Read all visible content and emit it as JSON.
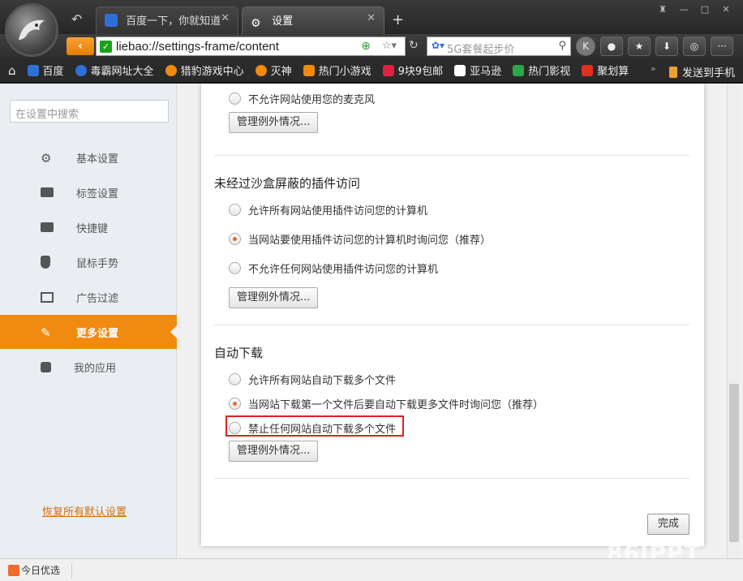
{
  "tabs": [
    {
      "label": "百度一下，你就知道",
      "icon": "baidu-paw-icon"
    },
    {
      "label": "设置",
      "icon": "gear-icon"
    }
  ],
  "window_controls": [
    "shirt-icon",
    "minimize-icon",
    "maximize-icon",
    "close-icon"
  ],
  "address_bar": {
    "url": "liebao://settings-frame/content"
  },
  "search_box": {
    "placeholder": "5G套餐起步价"
  },
  "toolbar_icons": [
    "account-icon",
    "lock-icon",
    "star-icon",
    "download-icon",
    "gamepad-icon",
    "more-icon"
  ],
  "bookmarks": [
    {
      "label": "百度",
      "color": "#2f6fd8"
    },
    {
      "label": "毒霸网址大全",
      "color": "#2f6fd8"
    },
    {
      "label": "猎豹游戏中心",
      "color": "#f08a10"
    },
    {
      "label": "灭神",
      "color": "#f08a10"
    },
    {
      "label": "热门小游戏",
      "color": "#f08a10"
    },
    {
      "label": "9块9包邮",
      "color": "#e02040"
    },
    {
      "label": "亚马逊",
      "color": "#222222"
    },
    {
      "label": "热门影视",
      "color": "#2aa84a"
    },
    {
      "label": "聚划算",
      "color": "#e03020"
    }
  ],
  "send_to_phone": "发送到手机",
  "sidebar": {
    "search_placeholder": "在设置中搜索",
    "items": [
      {
        "label": "基本设置",
        "icon": "gear-icon"
      },
      {
        "label": "标签设置",
        "icon": "tab-icon"
      },
      {
        "label": "快捷键",
        "icon": "keyboard-icon"
      },
      {
        "label": "鼠标手势",
        "icon": "mouse-icon"
      },
      {
        "label": "广告过滤",
        "icon": "window-icon"
      },
      {
        "label": "更多设置",
        "icon": "wrench-icon",
        "active": true
      },
      {
        "label": "我的应用",
        "icon": "puzzle-icon"
      }
    ],
    "restore": "恢复所有默认设置"
  },
  "panel": {
    "mic_option": "不允许网站使用您的麦克风",
    "manage_exceptions": "管理例外情况...",
    "plugin_section": {
      "title": "未经过沙盒屏蔽的插件访问",
      "options": [
        {
          "label": "允许所有网站使用插件访问您的计算机",
          "selected": false
        },
        {
          "label": "当网站要使用插件访问您的计算机时询问您（推荐）",
          "selected": true
        },
        {
          "label": "不允许任何网站使用插件访问您的计算机",
          "selected": false
        }
      ]
    },
    "download_section": {
      "title": "自动下载",
      "options": [
        {
          "label": "允许所有网站自动下载多个文件",
          "selected": false
        },
        {
          "label": "当网站下载第一个文件后要自动下载更多文件时询问您（推荐）",
          "selected": true
        },
        {
          "label": "禁止任何网站自动下载多个文件",
          "selected": false
        }
      ]
    },
    "done": "完成"
  },
  "statusbar": {
    "label": "今日优选"
  },
  "watermark": "86IPPT"
}
